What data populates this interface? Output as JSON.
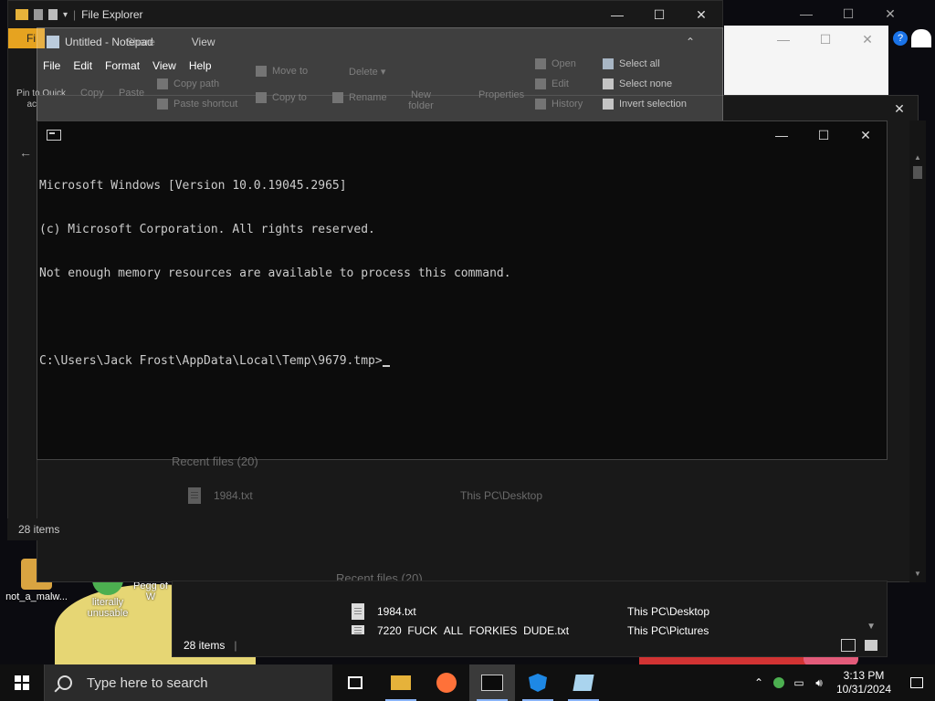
{
  "file_explorer_back": {
    "title": "File Explorer",
    "file_tab": "Fi",
    "pin_label": "Pin to Quick access",
    "status": "28 items"
  },
  "notepad": {
    "title": "Untitled - Notepad",
    "share_tab": "Share",
    "view_tab": "View",
    "menu": [
      "File",
      "Edit",
      "Format",
      "View",
      "Help"
    ]
  },
  "ribbon": {
    "copy": "Copy",
    "paste": "Paste",
    "copy_path": "Copy path",
    "paste_shortcut": "Paste shortcut",
    "move_to": "Move to",
    "copy_to": "Copy to",
    "delete": "Delete",
    "rename": "Rename",
    "new_folder": "New folder",
    "properties": "Properties",
    "open": "Open",
    "edit": "Edit",
    "history": "History",
    "select_all": "Select all",
    "select_none": "Select none",
    "invert_selection": "Invert selection"
  },
  "cmd": {
    "title": "",
    "lines": [
      "Microsoft Windows [Version 10.0.19045.2965]",
      "(c) Microsoft Corporation. All rights reserved.",
      "Not enough memory resources are available to process this command.",
      "",
      "C:\\Users\\Jack Frost\\AppData\\Local\\Temp\\9679.tmp>"
    ]
  },
  "explorer_recent": {
    "header_back": "Recent files (20)",
    "header_front": "Recent files (20)",
    "files": [
      {
        "name": "1984.txt",
        "location": "This PC\\Desktop"
      },
      {
        "name": "7220_FUCK_ALL_FORKIES_DUDE.txt",
        "location": "This PC\\Pictures"
      }
    ],
    "status": "28 items"
  },
  "desktop_icons": [
    {
      "label": "not_a_malw...",
      "color": "#d9a441"
    },
    {
      "label": "literally unusable",
      "color": "#4caf50"
    },
    {
      "label": "Pegg of W",
      "color": "#4a7fd6"
    }
  ],
  "taskbar": {
    "search_placeholder": "Type here to search",
    "time": "3:13 PM",
    "date": "10/31/2024"
  }
}
